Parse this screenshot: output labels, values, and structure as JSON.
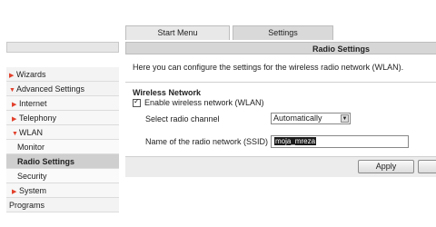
{
  "tabs": [
    {
      "label": "Start Menu"
    },
    {
      "label": "Settings"
    }
  ],
  "sidebar": {
    "items": [
      {
        "label": "Wizards"
      },
      {
        "label": "Advanced Settings"
      },
      {
        "label": "Internet"
      },
      {
        "label": "Telephony"
      },
      {
        "label": "WLAN"
      },
      {
        "label": "Monitor"
      },
      {
        "label": "Radio Settings"
      },
      {
        "label": "Security"
      },
      {
        "label": "System"
      },
      {
        "label": "Programs"
      }
    ]
  },
  "main": {
    "title": "Radio Settings",
    "description": "Here you can configure the settings for the wireless radio network (WLAN).",
    "section_title": "Wireless Network",
    "enable_label": "Enable wireless network (WLAN)",
    "channel_label": "Select radio channel",
    "channel_value": "Automatically",
    "ssid_label": "Name of the radio network (SSID)",
    "ssid_value": "moja_mreza",
    "apply_label": "Apply"
  },
  "colors": {
    "accent_arrow": "#e2402b"
  },
  "icons": {
    "expand": "triangle-right-icon",
    "collapse": "triangle-down-icon",
    "checkbox": "checkmark-icon",
    "dropdown": "chevron-down-icon"
  }
}
